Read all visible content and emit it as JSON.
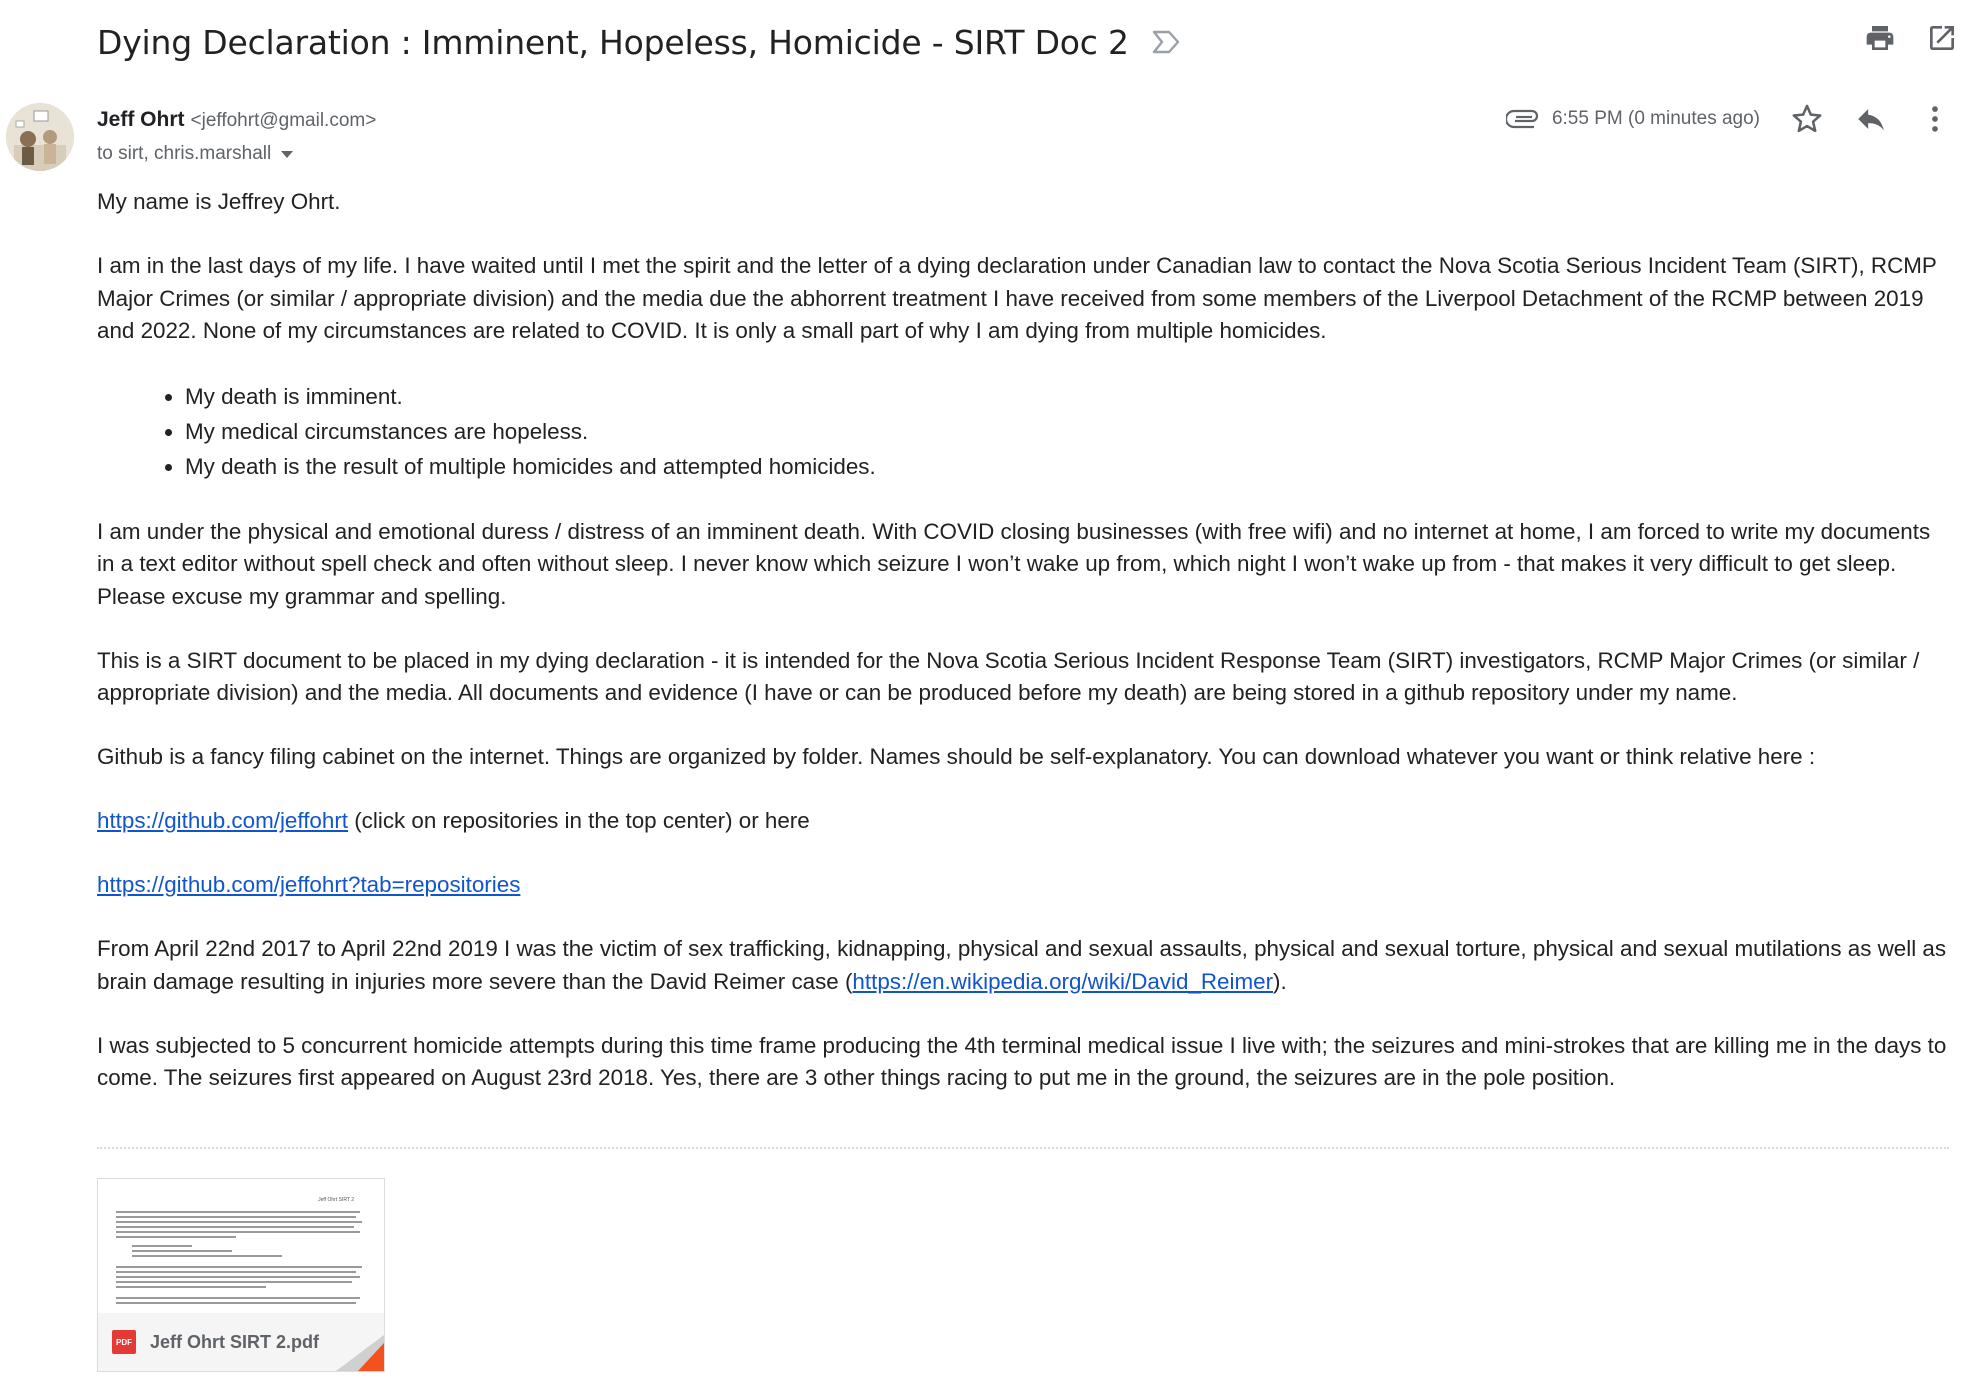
{
  "email": {
    "subject": "Dying Declaration : Imminent, Hopeless, Homicide - SIRT Doc 2",
    "sender_name": "Jeff Ohrt",
    "sender_email": "<jeffohrt@gmail.com>",
    "recipients": "to sirt, chris.marshall",
    "time": "6:55 PM (0 minutes ago)"
  },
  "icons": {
    "important": "important-marker-icon",
    "print": "print-icon",
    "open_new_window": "open-in-new-window-icon",
    "attachment": "paperclip-icon",
    "star": "star-icon",
    "reply": "reply-icon",
    "more": "more-vert-icon"
  },
  "body": {
    "p1": "My name is Jeffrey Ohrt.",
    "p2": "I am in the last days of my life.  I have waited until I met the spirit and the letter of a dying declaration under Canadian law to contact the Nova Scotia Serious Incident Team (SIRT), RCMP Major Crimes (or similar / appropriate division) and the media due the abhorrent treatment I have received from some members of the Liverpool Detachment of the RCMP between 2019 and 2022.  None of my circumstances are related to COVID.  It is only a small part of why I am dying from multiple homicides.",
    "bullets": [
      "My death is imminent.",
      "My medical circumstances are hopeless.",
      "My death is the result of multiple homicides and attempted homicides."
    ],
    "p3": "I am under the physical and emotional duress / distress of an imminent death.  With COVID closing businesses (with free wifi) and no internet at home, I am forced to write my documents in a text editor without spell check and often without sleep.  I never know which seizure I won’t wake up from, which night I won’t wake up from - that makes it very difficult to get sleep.  Please excuse my grammar and spelling.",
    "p4": "This is a SIRT document to be placed in my dying declaration - it is intended for the Nova Scotia Serious Incident Response Team (SIRT) investigators, RCMP Major Crimes (or similar / appropriate division) and the media.  All documents and evidence (I have or can be produced before my death) are being stored in a github repository under my name.",
    "p5": "Github is a fancy filing cabinet on the internet.  Things are organized by folder.  Names should be self-explanatory.  You can download whatever you want or think relative here :",
    "link1": "https://github.com/jeffohrt",
    "link1_after": " (click on repositories in the top center) or here",
    "link2": "https://github.com/jeffohrt?tab=repositories",
    "p6_before": "From April 22nd 2017 to April 22nd 2019 I was the victim of sex trafficking, kidnapping, physical and sexual assaults, physical and sexual torture, physical and sexual mutilations as well as brain damage resulting in injuries more severe than the David Reimer case (",
    "link3": "https://en.wikipedia.org/wiki/David_Reimer",
    "p6_after": ").",
    "p7": "I was subjected to 5 concurrent homicide attempts during this time frame producing the 4th terminal medical issue I live with; the seizures and mini-strokes that are killing me in the days to come.  The seizures first appeared on August 23rd 2018.  Yes, there are 3 other things racing to put me in the ground, the seizures are in the pole position."
  },
  "attachment": {
    "file_name": "Jeff Ohrt SIRT 2.pdf",
    "badge": "PDF",
    "preview_header": "Jeff Ohrt SIRT 2"
  },
  "colors": {
    "link": "#1155cc",
    "pdf_badge": "#e53935",
    "fold": "#f4511e"
  }
}
